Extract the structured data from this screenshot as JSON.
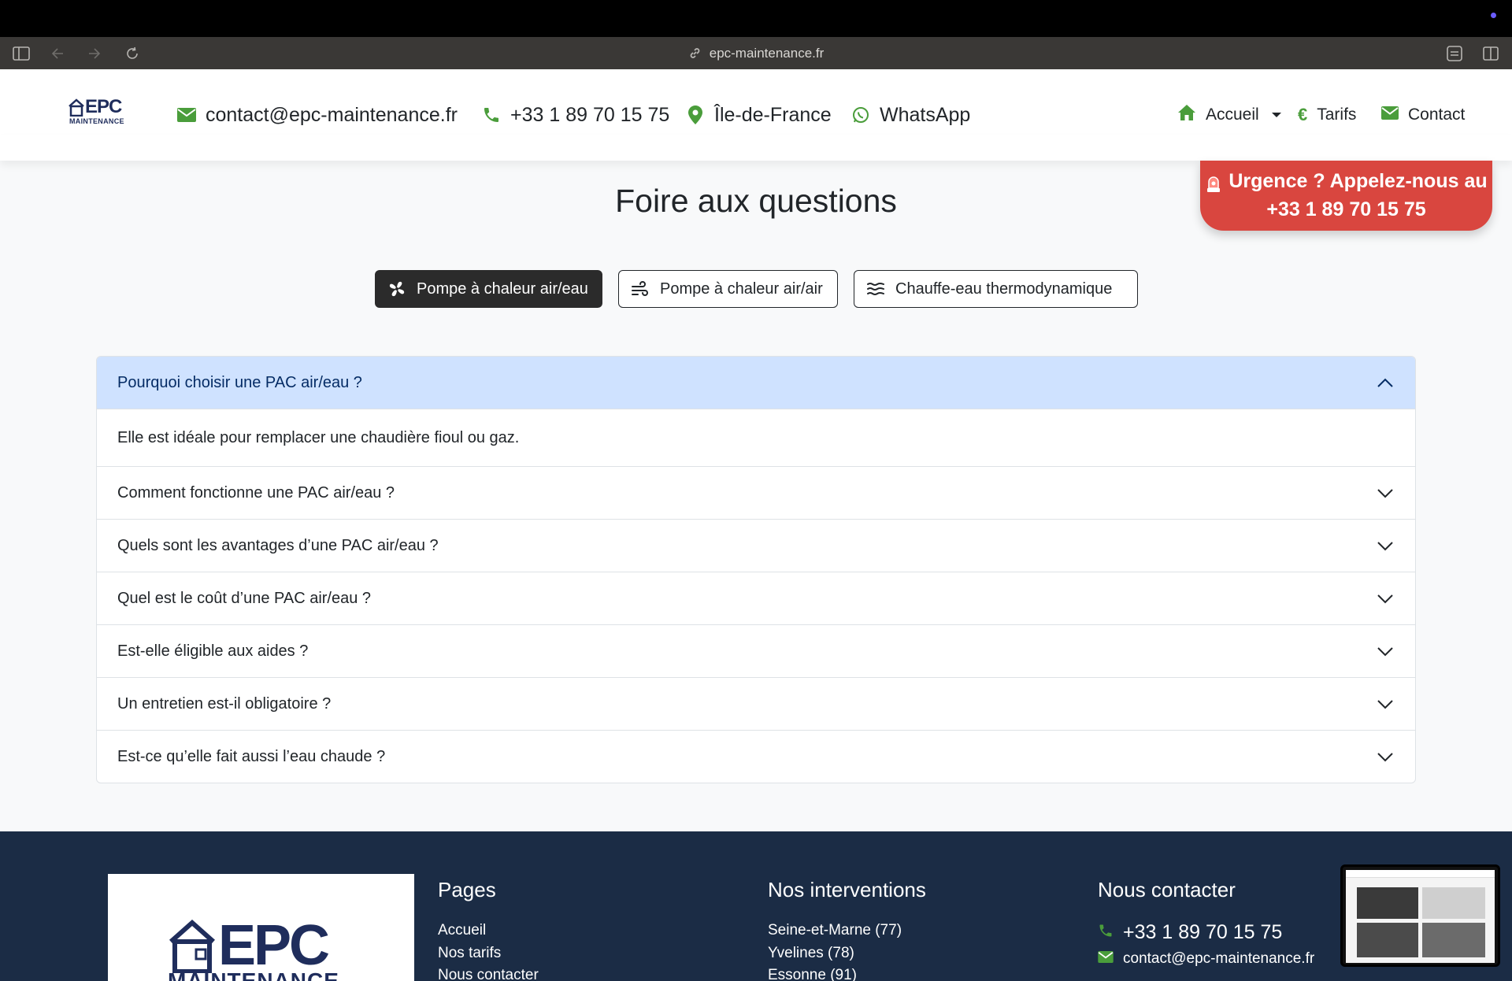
{
  "browser": {
    "url": "epc-maintenance.fr"
  },
  "header": {
    "logo_text": "EPC",
    "logo_sub": "MAINTENANCE",
    "email": "contact@epc-maintenance.fr",
    "phone": "+33 1 89 70 15 75",
    "region": "Île-de-France",
    "whatsapp": "WhatsApp",
    "nav": {
      "home": "Accueil",
      "pricing": "Tarifs",
      "contact": "Contact"
    }
  },
  "urgency": {
    "line1": "Urgence ? Appelez-nous au",
    "line2": "+33 1 89 70 15 75"
  },
  "faq": {
    "title": "Foire aux questions",
    "tabs": [
      {
        "label": "Pompe à chaleur air/eau",
        "active": true
      },
      {
        "label": "Pompe à chaleur air/air",
        "active": false
      },
      {
        "label": "Chauffe-eau thermodynamique",
        "active": false
      }
    ],
    "items": [
      {
        "question": "Pourquoi choisir une PAC air/eau ?",
        "answer": "Elle est idéale pour remplacer une chaudière fioul ou gaz.",
        "open": true
      },
      {
        "question": "Comment fonctionne une PAC air/eau ?"
      },
      {
        "question": "Quels sont les avantages d’une PAC air/eau ?"
      },
      {
        "question": "Quel est le coût d’une PAC air/eau ?"
      },
      {
        "question": "Est-elle éligible aux aides ?"
      },
      {
        "question": "Un entretien est-il obligatoire ?"
      },
      {
        "question": "Est-ce qu’elle fait aussi l’eau chaude ?"
      }
    ]
  },
  "footer": {
    "logo_text": "EPC",
    "logo_sub": "MAINTENANCE",
    "pages": {
      "title": "Pages",
      "links": [
        "Accueil",
        "Nos tarifs",
        "Nous contacter"
      ]
    },
    "interventions": {
      "title": "Nos interventions",
      "links": [
        "Seine-et-Marne (77)",
        "Yvelines (78)",
        "Essonne (91)"
      ]
    },
    "contact": {
      "title": "Nous contacter",
      "phone": "+33 1 89 70 15 75",
      "email": "contact@epc-maintenance.fr"
    }
  },
  "colors": {
    "accent_green": "#4a9d3b",
    "urgency_red": "#d9463f",
    "footer_navy": "#1b2c45",
    "accordion_open": "#cfe2ff"
  }
}
